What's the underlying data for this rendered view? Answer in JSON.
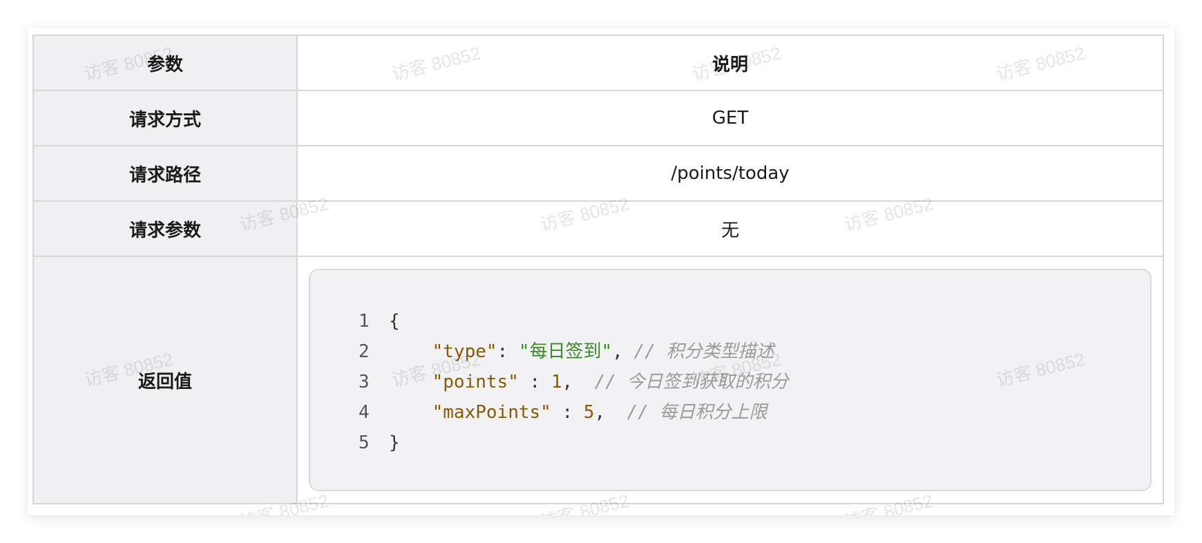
{
  "table": {
    "header": {
      "key": "参数",
      "value": "说明"
    },
    "rows": [
      {
        "key": "请求方式",
        "value": "GET"
      },
      {
        "key": "请求路径",
        "value": "/points/today"
      },
      {
        "key": "请求参数",
        "value": "无"
      }
    ],
    "return_row": {
      "key": "返回值"
    }
  },
  "code": {
    "lines": [
      {
        "n": "1",
        "open": "{"
      },
      {
        "n": "2",
        "key": "\"type\"",
        "sep": ": ",
        "val": "\"每日签到\"",
        "tail": ", ",
        "comment": "// 积分类型描述"
      },
      {
        "n": "3",
        "key": "\"points\"",
        "sep": " : ",
        "val": "1",
        "tail": ",  ",
        "comment": "// 今日签到获取的积分"
      },
      {
        "n": "4",
        "key": "\"maxPoints\"",
        "sep": " : ",
        "val": "5",
        "tail": ",  ",
        "comment": "// 每日积分上限"
      },
      {
        "n": "5",
        "close": "}"
      }
    ]
  },
  "watermark": {
    "text": "访客 80852"
  },
  "colors": {
    "key_cell_bg": "#f0f0f2",
    "border": "#d6d6d6",
    "code_bg": "#f2f2f4",
    "json_key": "#8a5a00",
    "json_string": "#3a8a2a",
    "json_number": "#8a5a00",
    "comment": "#9a9a9a"
  }
}
